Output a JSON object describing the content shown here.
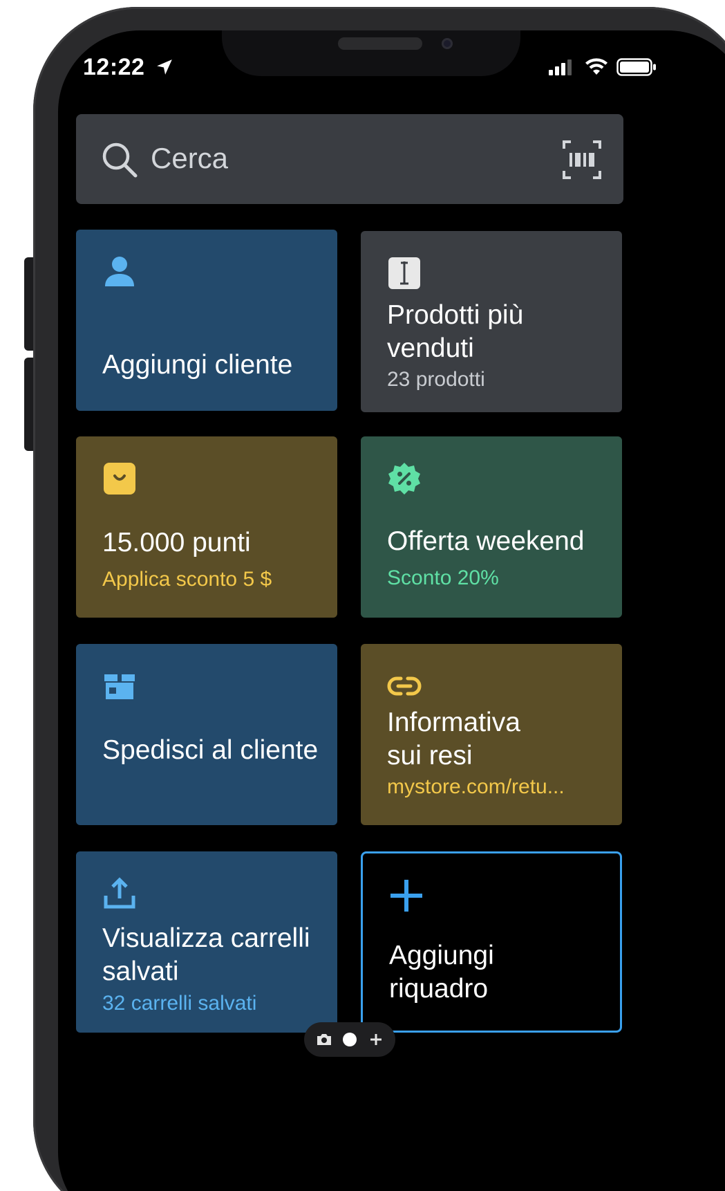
{
  "status_bar": {
    "time": "12:22"
  },
  "search": {
    "placeholder": "Cerca"
  },
  "tiles": [
    {
      "title": "Aggiungi cliente",
      "subtitle": "",
      "icon": "person-icon",
      "color": "#234a6c"
    },
    {
      "title": "Prodotti più venduti",
      "subtitle": "23 prodotti",
      "icon": "product-icon",
      "color": "#3b3e43"
    },
    {
      "title": "15.000 punti",
      "subtitle": "Applica sconto 5 $",
      "icon": "loyalty-icon",
      "color": "#5b4e27",
      "subtitle_color": "#f3c84a"
    },
    {
      "title": "Offerta weekend",
      "subtitle": "Sconto 20%",
      "icon": "discount-icon",
      "color": "#2f5648",
      "subtitle_color": "#5fe0a5"
    },
    {
      "title": "Spedisci al cliente",
      "subtitle": "",
      "icon": "shipping-icon",
      "color": "#234a6c"
    },
    {
      "title": "Informativa sui resi",
      "subtitle": "mystore.com/retu...",
      "icon": "link-icon",
      "color": "#5b4e27",
      "subtitle_color": "#f3c84a"
    },
    {
      "title": "Visualizza carrelli salvati",
      "subtitle": "32 carrelli salvati",
      "icon": "upload-icon",
      "color": "#234a6c",
      "subtitle_color": "#5bb3f0"
    },
    {
      "title": "Aggiungi riquadro",
      "subtitle": "",
      "icon": "plus-icon",
      "color": "#000000",
      "accent": "#3aa0ee"
    }
  ],
  "pager": {
    "pages": [
      "camera-icon",
      "current-page-dot",
      "plus-icon"
    ],
    "current": 1
  }
}
